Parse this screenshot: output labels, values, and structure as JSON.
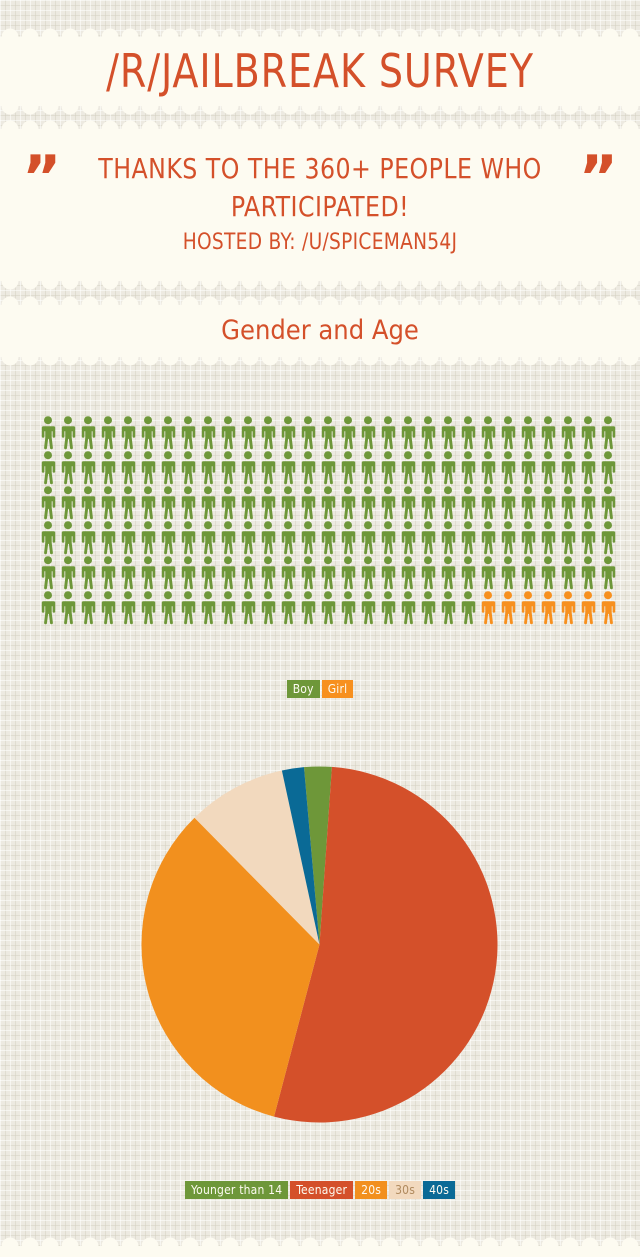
{
  "header": {
    "title": "/R/JAILBREAK SURVEY"
  },
  "quote": {
    "mark_left": "”",
    "mark_right": "”",
    "line1": "THANKS TO THE 360+ PEOPLE WHO PARTICIPATED!",
    "host": "HOSTED BY: /U/SPICEMAN54J"
  },
  "section": {
    "title": "Gender and Age"
  },
  "colors": {
    "accent_red": "#D4502A",
    "green": "#6E9739",
    "orange": "#F7901E",
    "tan": "#F2D9BE",
    "blue": "#0A6A96",
    "cream": "#FDFBF1",
    "paper": "#EDEAE1"
  },
  "chart_data": [
    {
      "type": "pictogram",
      "title": "Gender and Age",
      "unit_label": "person",
      "columns": 29,
      "rows": 6,
      "total_icons": 174,
      "categories": [
        "Boy",
        "Girl"
      ],
      "values": [
        167,
        7
      ],
      "percents": [
        96.0,
        4.0
      ],
      "series_colors": [
        "#6E9739",
        "#F7901E"
      ],
      "legend": [
        {
          "label": "Boy",
          "color": "#6E9739"
        },
        {
          "label": "Girl",
          "color": "#F7901E"
        }
      ],
      "legend_position": "bottom"
    },
    {
      "type": "pie",
      "title": "Age",
      "categories": [
        "Younger than 14",
        "Teenager",
        "20s",
        "30s",
        "40s"
      ],
      "values": [
        2.5,
        53.0,
        33.5,
        9.0,
        2.0
      ],
      "percents": [
        2.5,
        53.0,
        33.5,
        9.0,
        2.0
      ],
      "slice_colors": [
        "#6E9739",
        "#D4502A",
        "#F2901E",
        "#F2D9BE",
        "#0A6A96"
      ],
      "start_angle_deg": -5,
      "legend": [
        {
          "label": "Younger than 14",
          "color": "#6E9739"
        },
        {
          "label": "Teenager",
          "color": "#D4502A"
        },
        {
          "label": "20s",
          "color": "#F2901E"
        },
        {
          "label": "30s",
          "color": "#F2D9BE",
          "text_color": "#B08A5E"
        },
        {
          "label": "40s",
          "color": "#0A6A96"
        }
      ],
      "legend_position": "bottom"
    }
  ]
}
